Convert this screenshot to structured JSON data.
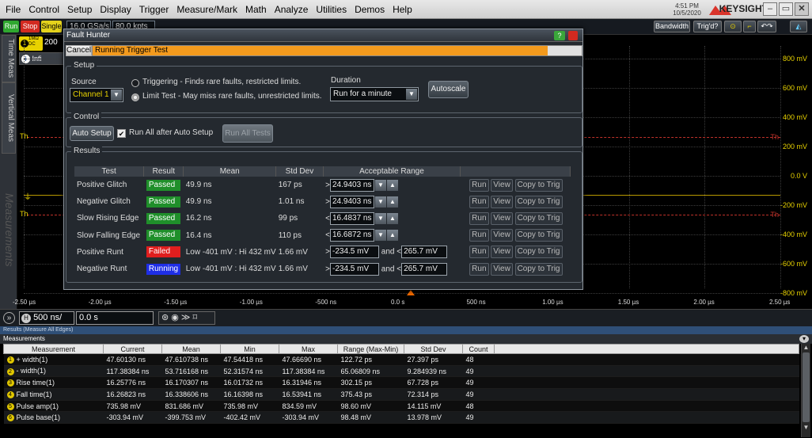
{
  "menu": [
    "File",
    "Control",
    "Setup",
    "Display",
    "Trigger",
    "Measure/Mark",
    "Math",
    "Analyze",
    "Utilities",
    "Demos",
    "Help"
  ],
  "clock": {
    "time": "4:51 PM",
    "date": "10/5/2020"
  },
  "brand": "KEYSIGHT",
  "brand_sub": "TECHNOLOGIES",
  "toolbar": {
    "run": "Run",
    "stop": "Stop",
    "single": "Single",
    "sample_rate": "16.0 GSa/s",
    "points": "80.0 kpts",
    "bandwidth": "Bandwidth",
    "trigd": "Trig'd?"
  },
  "channel_badge": {
    "num": "1",
    "line1": "1MΩ",
    "line2": "DC",
    "scale": "200"
  },
  "info_text": "Infi",
  "left_tabs": [
    "Time Meas",
    "Vertical Meas",
    "Measurements"
  ],
  "y_axis": [
    "800 mV",
    "600 mV",
    "400 mV",
    "200 mV",
    "0.0 V",
    "-200 mV",
    "-400 mV",
    "-600 mV",
    "-800 mV"
  ],
  "x_axis": [
    "-2.50 µs",
    "-2.00 µs",
    "-1.50 µs",
    "-1.00 µs",
    "-500 ns",
    "0.0 s",
    "500 ns",
    "1.00 µs",
    "1.50 µs",
    "2.00 µs",
    "2.50 µs"
  ],
  "th_label": "Th",
  "bottom": {
    "channel": "H",
    "timebase": "500 ns/",
    "delay": "0.0 s"
  },
  "dialog": {
    "title": "Fault Hunter",
    "help": "?",
    "cancel": "Cancel",
    "progress_text": "Running Trigger Test",
    "progress": 0.93,
    "setup": {
      "title": "Setup",
      "source_label": "Source",
      "source_value": "Channel 1",
      "radio1": "Triggering - Finds rare faults, restricted limits.",
      "radio2": "Limit Test - May miss rare faults, unrestricted limits.",
      "duration_label": "Duration",
      "duration_value": "Run for a minute",
      "autoscale": "Autoscale"
    },
    "control": {
      "title": "Control",
      "auto_setup": "Auto Setup",
      "run_all_after": "Run All after Auto Setup",
      "run_all_tests": "Run All Tests"
    },
    "results": {
      "title": "Results",
      "headers": [
        "Test",
        "Result",
        "Mean",
        "Std Dev",
        "Acceptable Range"
      ],
      "rows": [
        {
          "test": "Positive Glitch",
          "result": "Passed",
          "color": "#1f8f2a",
          "mean": "49.9 ns",
          "std": "167 ps",
          "op": ">",
          "range": "24.9403 ns",
          "op2": "",
          "range2": ""
        },
        {
          "test": "Negative Glitch",
          "result": "Passed",
          "color": "#1f8f2a",
          "mean": "49.9 ns",
          "std": "1.01 ns",
          "op": ">",
          "range": "24.9403 ns",
          "op2": "",
          "range2": ""
        },
        {
          "test": "Slow Rising Edge",
          "result": "Passed",
          "color": "#1f8f2a",
          "mean": "16.2 ns",
          "std": "99 ps",
          "op": "<",
          "range": "16.4837 ns",
          "op2": "",
          "range2": ""
        },
        {
          "test": "Slow Falling Edge",
          "result": "Passed",
          "color": "#1f8f2a",
          "mean": "16.4 ns",
          "std": "110 ps",
          "op": "<",
          "range": "16.6872 ns",
          "op2": "",
          "range2": ""
        },
        {
          "test": "Positive Runt",
          "result": "Failed",
          "color": "#e01e1e",
          "mean": "Low -401 mV : Hi 432 mV",
          "std": "1.66 mV",
          "op": ">",
          "range": "-234.5 mV",
          "op2": "and <",
          "range2": "265.7 mV"
        },
        {
          "test": "Negative Runt",
          "result": "Running",
          "color": "#1e2ee6",
          "mean": "Low -401 mV : Hi 432 mV",
          "std": "1.66 mV",
          "op": ">",
          "range": "-234.5 mV",
          "op2": "and <",
          "range2": "265.7 mV"
        }
      ],
      "run": "Run",
      "view": "View",
      "copy": "Copy to Trig"
    }
  },
  "results_bar": "Results  (Measure All Edges)",
  "measurements_bar": "Measurements",
  "meas_table": {
    "headers": [
      "Measurement",
      "Current",
      "Mean",
      "Min",
      "Max",
      "Range (Max-Min)",
      "Std Dev",
      "Count"
    ],
    "rows": [
      [
        "1",
        "+ width(1)",
        "47.60130 ns",
        "47.610738 ns",
        "47.54418 ns",
        "47.66690 ns",
        "122.72 ps",
        "27.397 ps",
        "48"
      ],
      [
        "2",
        "- width(1)",
        "117.38384 ns",
        "53.716168 ns",
        "52.31574 ns",
        "117.38384 ns",
        "65.06809 ns",
        "9.284939 ns",
        "49"
      ],
      [
        "3",
        "Rise time(1)",
        "16.25776 ns",
        "16.170307 ns",
        "16.01732 ns",
        "16.31946 ns",
        "302.15 ps",
        "67.728 ps",
        "49"
      ],
      [
        "4",
        "Fall time(1)",
        "16.26823 ns",
        "16.338606 ns",
        "16.16398 ns",
        "16.53941 ns",
        "375.43 ps",
        "72.314 ps",
        "49"
      ],
      [
        "5",
        "Pulse amp(1)",
        "735.98 mV",
        "831.686 mV",
        "735.98 mV",
        "834.59 mV",
        "98.60 mV",
        "14.115 mV",
        "48"
      ],
      [
        "6",
        "Pulse base(1)",
        "-303.94 mV",
        "-399.753 mV",
        "-402.42 mV",
        "-303.94 mV",
        "98.48 mV",
        "13.978 mV",
        "49"
      ]
    ]
  }
}
